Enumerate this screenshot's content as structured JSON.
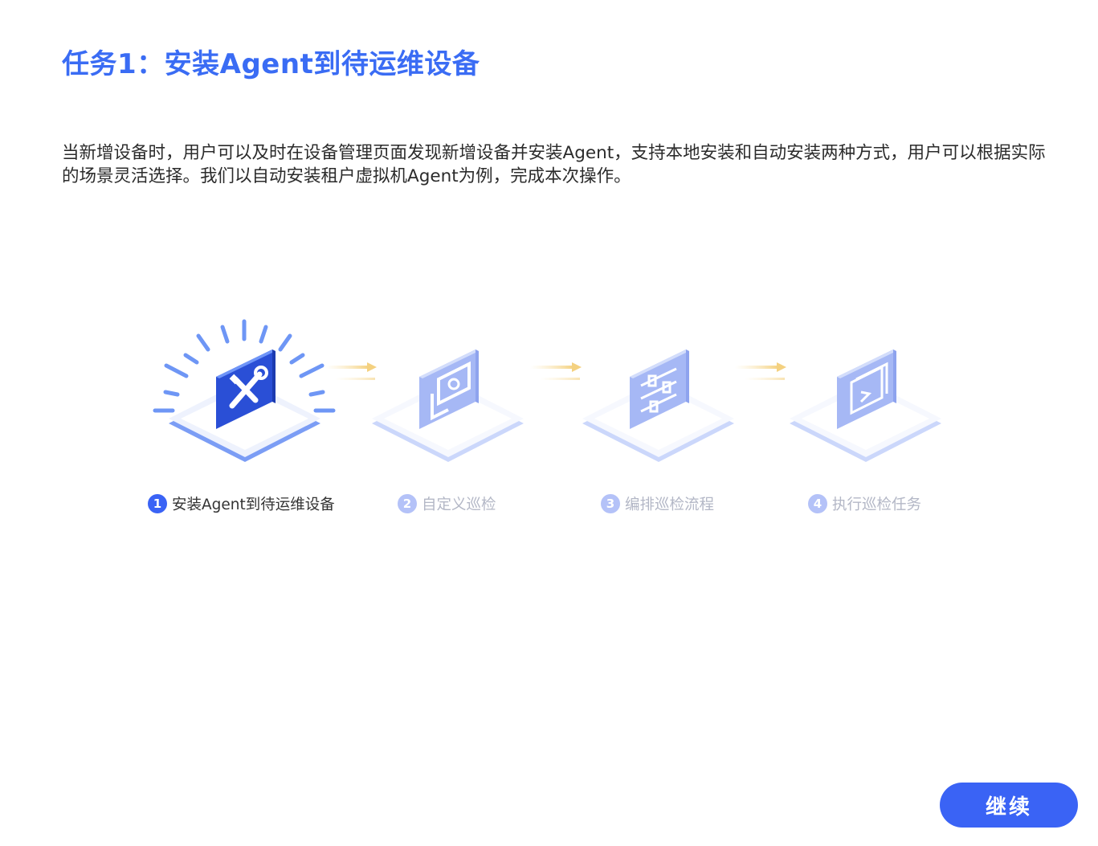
{
  "page": {
    "title": "任务1：安装Agent到待运维设备",
    "description": "当新增设备时，用户可以及时在设备管理页面发现新增设备并安装Agent，支持本地安装和自动安装两种方式，用户可以根据实际的场景灵活选择。我们以自动安装租户虚拟机Agent为例，完成本次操作。"
  },
  "steps": [
    {
      "number": "1",
      "label": "安装Agent到待运维设备",
      "state": "active",
      "icon": "wrench-screwdriver-icon"
    },
    {
      "number": "2",
      "label": "自定义巡检",
      "state": "inactive",
      "icon": "gear-window-icon"
    },
    {
      "number": "3",
      "label": "编排巡检流程",
      "state": "inactive",
      "icon": "sliders-icon"
    },
    {
      "number": "4",
      "label": "执行巡检任务",
      "state": "inactive",
      "icon": "terminal-icon"
    }
  ],
  "actions": {
    "continue_label": "继续"
  },
  "colors": {
    "accent": "#3a63f5",
    "title": "#3a6cf4",
    "inactive_icon": "#a9b9f6",
    "inactive_text": "#b3b7c6",
    "arrow": "#f6d98a"
  }
}
